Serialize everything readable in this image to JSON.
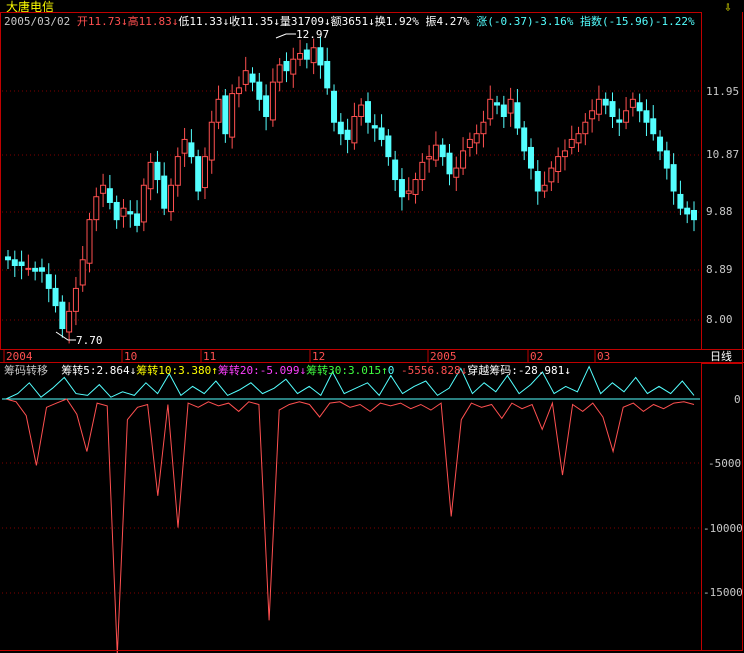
{
  "stock": {
    "name": "大唐电信",
    "date": "2005/03/02",
    "open_label": "开",
    "open": "11.73",
    "high_label": "高",
    "high": "11.83",
    "low_label": "低",
    "low": "11.33",
    "close_label": "收",
    "close": "11.35",
    "vol_label": "量",
    "vol": "31709",
    "amt_label": "额",
    "amt": "3651",
    "turn_label": "换",
    "turn": "1.92%",
    "amp_label": "振",
    "amp": "4.27%",
    "chg_label": "涨",
    "chg": "(-0.37)-3.16%",
    "idx_label": "指数",
    "idx": "(-15.96)-1.22%",
    "down_arrow": "↓",
    "up_arrow": "↑",
    "pin_icon": "⇩"
  },
  "price_axis": {
    "ticks": [
      "11.95",
      "10.87",
      "9.88",
      "8.89",
      "8.00"
    ],
    "max_label": "12.97",
    "min_label": "7.70"
  },
  "time_axis": {
    "labels": [
      "2004",
      "10",
      "11",
      "12",
      "2005",
      "02",
      "03"
    ],
    "period": "日线"
  },
  "indicator": {
    "name": "筹码转移",
    "s5_label": "筹转5:",
    "s5": "2.864",
    "s10_label": "筹转10:",
    "s10": "3.380",
    "s20_label": "筹转20:",
    "s20": "-5.099",
    "s30_label": "筹转30:",
    "s30": "3.015",
    "zero": "0",
    "neg_value": "-5556.828",
    "cross_label": "穿越筹码:",
    "cross": "-28.981",
    "ticks": [
      "0",
      "-5000",
      "-10000",
      "-15000"
    ]
  },
  "colors": {
    "up": "#ff5050",
    "down": "#54ffff",
    "frame": "#c00000",
    "title": "#ffff00",
    "grid": "#800000"
  },
  "chart_data": [
    {
      "type": "candlestick",
      "ylim": [
        7.7,
        12.97
      ],
      "annotations": [
        "12.97",
        "7.70"
      ],
      "x": [
        "2004",
        "10",
        "11",
        "12",
        "2005",
        "02",
        "03"
      ],
      "series": [
        {
          "values": [
            9.1,
            9.0,
            9.0,
            8.95,
            8.9,
            8.9,
            8.6,
            8.3,
            7.9,
            8.2,
            8.6,
            9.1,
            9.8,
            10.2,
            10.4,
            10.1,
            9.8,
            10.0,
            9.9,
            9.7,
            10.4,
            10.8,
            10.5,
            10.0,
            10.4,
            10.9,
            11.2,
            10.9,
            10.3,
            10.9,
            11.5,
            11.9,
            11.3,
            12.0,
            12.1,
            12.4,
            12.2,
            11.9,
            11.6,
            12.2,
            12.5,
            12.4,
            12.6,
            12.7,
            12.6,
            12.8,
            12.5,
            12.1,
            11.5,
            11.3,
            11.2,
            11.6,
            11.8,
            11.5,
            11.4,
            11.2,
            10.9,
            10.5,
            10.2,
            10.3,
            10.5,
            10.8,
            10.9,
            11.1,
            10.9,
            10.6,
            10.7,
            11.0,
            11.2,
            11.3,
            11.5,
            11.9,
            11.8,
            11.6,
            11.9,
            11.4,
            11.0,
            10.7,
            10.3,
            10.4,
            10.7,
            10.9,
            11.0,
            11.2,
            11.3,
            11.5,
            11.7,
            11.9,
            11.8,
            11.6,
            11.5,
            11.7,
            11.9,
            11.7,
            11.5,
            11.3,
            11.0,
            10.7,
            10.3,
            10.0,
            9.9,
            9.8
          ]
        }
      ]
    },
    {
      "type": "line",
      "ylim": [
        -17500,
        1000
      ],
      "series": [
        {
          "name": "筹转5",
          "values": [
            0,
            -200,
            -1200,
            -4800,
            -600,
            -300,
            0,
            -1100,
            -3800,
            -300,
            -500,
            -18500,
            -1500,
            -600,
            -400,
            -7000,
            -400,
            -9300,
            -300,
            -600,
            -200,
            -500,
            -300,
            -900,
            -200,
            -400,
            -16000,
            -800,
            -400,
            -200,
            -400,
            -1300,
            -300,
            -200,
            -600,
            -400,
            -900,
            -300,
            -500,
            -300,
            -700,
            -400,
            -800,
            -300,
            -8500,
            -1500,
            -300,
            -600,
            -400,
            -1400,
            -300,
            -700,
            -400,
            -2200,
            -300,
            -5500,
            -400,
            -900,
            -300,
            -1300,
            -3800,
            -600,
            -300,
            -900,
            -400,
            -700,
            -300,
            -200,
            -400
          ]
        },
        {
          "name": "筹转10",
          "values": [
            0,
            300,
            900,
            100,
            600,
            1200,
            300,
            200,
            800,
            100,
            400,
            200,
            900,
            300,
            1400,
            200,
            700,
            300,
            1000,
            200,
            500,
            900,
            300,
            600,
            1100,
            300,
            700,
            200,
            1500,
            300,
            600,
            900,
            200,
            1300,
            300,
            700,
            1000,
            200,
            600,
            1700,
            300,
            900,
            400,
            1300,
            300,
            800,
            1500,
            300,
            700,
            400,
            1800,
            300,
            900,
            400,
            1200,
            300,
            700,
            300,
            1000,
            200
          ]
        }
      ]
    }
  ]
}
